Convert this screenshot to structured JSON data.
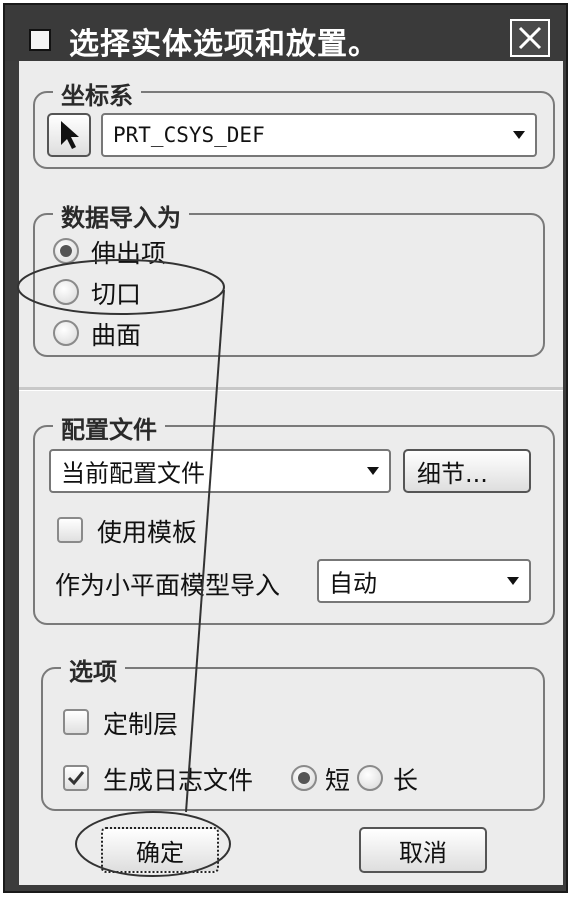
{
  "dialog": {
    "title": "选择实体选项和放置。",
    "close_label": "✕"
  },
  "csys_group": {
    "legend": "坐标系",
    "select_icon": "arrow-pointer-icon",
    "value": "PRT_CSYS_DEF"
  },
  "import_group": {
    "legend": "数据导入为",
    "options": [
      {
        "label": "伸出项",
        "selected": true
      },
      {
        "label": "切口",
        "selected": false
      },
      {
        "label": "曲面",
        "selected": false
      }
    ]
  },
  "profile_group": {
    "legend": "配置文件",
    "profile_value": "当前配置文件",
    "details_label": "细节...",
    "use_template_label": "使用模板",
    "use_template_checked": false,
    "facet_label": "作为小平面模型导入",
    "facet_value": "自动"
  },
  "options_group": {
    "legend": "选项",
    "custom_layer_label": "定制层",
    "custom_layer_checked": false,
    "log_label": "生成日志文件",
    "log_checked": true,
    "short_label": "短",
    "short_selected": true,
    "long_label": "长",
    "long_selected": false
  },
  "footer": {
    "ok_label": "确定",
    "cancel_label": "取消"
  },
  "colors": {
    "frame": "#3c3c3c",
    "client": "#ececec",
    "annotation": "#333333"
  }
}
